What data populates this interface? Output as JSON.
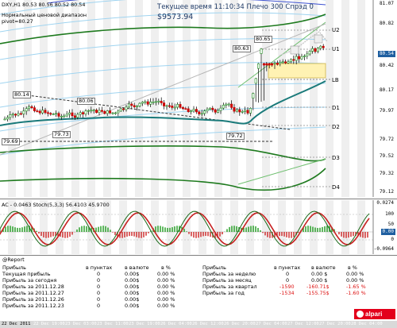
{
  "header": {
    "symbol_line": "DXY,H1  80.53 80.56 80.52 80.54",
    "indicator_name": "Нормальный ценовой диапазон",
    "pivot_line": "pivot=80.27",
    "balance": "$9573.94",
    "status": "Текущее время 11:10:34 Плечо 300 Спрэд 0"
  },
  "price_axis": {
    "labels": [
      "81.07",
      "80.82",
      "80.54",
      "80.42",
      "80.17",
      "79.97",
      "79.72",
      "79.52",
      "79.32",
      "79.12"
    ],
    "current_price": "80.54",
    "current_price_color": "#1f5fa0",
    "level_prices": [
      "80.82",
      "80.67",
      "80.42",
      "80.22",
      "79.97",
      "79.72",
      "79.47",
      "79.12"
    ]
  },
  "levels": {
    "U2": "U2",
    "U1": "U1",
    "LB": "LB",
    "D1": "D1",
    "D2": "D2",
    "D3": "D3",
    "D4": "D4"
  },
  "chart_tags": {
    "t1": "80.14",
    "t2": "80.06",
    "t3": "79.73",
    "t4": "79.69",
    "t5": "79.72",
    "t6": "80.63",
    "t7": "80.65"
  },
  "oscillator": {
    "header": "AC - 0.0463  Stoch(5,3,3) 56.4103 45.9700",
    "axis_top": "0.0274",
    "axis_mid_1": "100",
    "axis_mid_2": "50",
    "axis_mid_3": "0.00",
    "axis_mid_4": "0",
    "axis_bottom": "-0.0964"
  },
  "report": {
    "title": "@Report",
    "left_headers": [
      "Прибыль",
      "в пунктах",
      "в валюте",
      "в %"
    ],
    "right_headers": [
      "Прибыль",
      "в пунктах",
      "в валюте",
      "в %"
    ],
    "left_rows": [
      [
        "Текущая прибыль",
        "0",
        "0.00$",
        "0.00 %"
      ],
      [
        "Прибыль за сегодня",
        "0",
        "0.00$",
        "0.00 %"
      ],
      [
        "Прибыль за 2011.12.28",
        "0",
        "0.00$",
        "0.00 %"
      ],
      [
        "Прибыль за 2011.12.27",
        "0",
        "0.00$",
        "0.00 %"
      ],
      [
        "Прибыль за 2011.12.26",
        "0",
        "0.00$",
        "0.00 %"
      ],
      [
        "Прибыль за 2011.12.23",
        "0",
        "0.00$",
        "0.00 %"
      ]
    ],
    "right_rows": [
      [
        "Прибыль за неделю",
        "0",
        "0.00 $",
        "0.00 %"
      ],
      [
        "Прибыль за месяц",
        "0",
        "0.00 $",
        "0.00 %"
      ],
      [
        "Прибыль за квартал",
        "-1590",
        "-160.71$",
        "-1.65 %"
      ],
      [
        "Прибыль за год",
        "-1534",
        "-155.75$",
        "-1.60 %"
      ]
    ],
    "negative_color": "#dd1111",
    "logo": "alpari"
  },
  "time_axis": {
    "labels": [
      "22 Dec 2011",
      "22 Dec 19:00",
      "23 Dec 03:00",
      "23 Dec 11:00",
      "23 Dec 19:00",
      "26 Dec 04:00",
      "26 Dec 12:00",
      "26 Dec 20:00",
      "27 Dec 04:00",
      "27 Dec 12:00",
      "27 Dec 20:00",
      "28 Dec 04:00"
    ]
  }
}
